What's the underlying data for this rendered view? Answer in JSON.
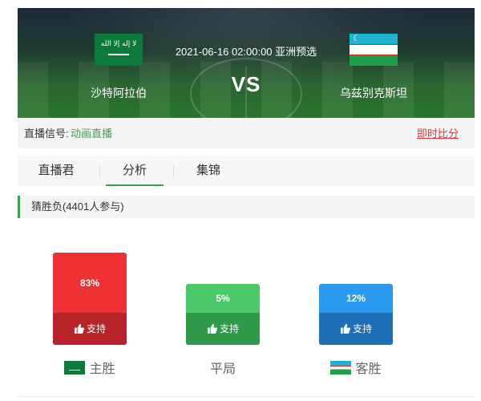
{
  "match": {
    "time_stage": "2021-06-16 02:00:00 亚洲预选",
    "vs": "VS",
    "home_team": "沙特阿拉伯",
    "away_team": "乌兹别克斯坦",
    "home_flag_script": "لا إله إلا الله"
  },
  "signal": {
    "label": "直播信号:",
    "link": "动画直播",
    "live_score": "即时比分"
  },
  "tabs": [
    {
      "label": "直播君",
      "active": false
    },
    {
      "label": "分析",
      "active": true
    },
    {
      "label": "集锦",
      "active": false
    }
  ],
  "section": {
    "title": "猜胜负(4401人参与)"
  },
  "votes": [
    {
      "percent_label": "83%",
      "percent": 83,
      "support": "支持",
      "name": "主胜",
      "top": "#ee3135",
      "bottom": "#b7252b",
      "flag": "home"
    },
    {
      "percent_label": "5%",
      "percent": 5,
      "support": "支持",
      "name": "平局",
      "top": "#4cc96a",
      "bottom": "#2f9a49",
      "flag": "none"
    },
    {
      "percent_label": "12%",
      "percent": 12,
      "support": "支持",
      "name": "客胜",
      "top": "#2a9af0",
      "bottom": "#1d6fb8",
      "flag": "away"
    }
  ],
  "colors": {
    "accent_green": "#3aa24f",
    "live_score_red": "#e03a3a"
  },
  "icons": {
    "support": "thumbs-up-icon"
  }
}
